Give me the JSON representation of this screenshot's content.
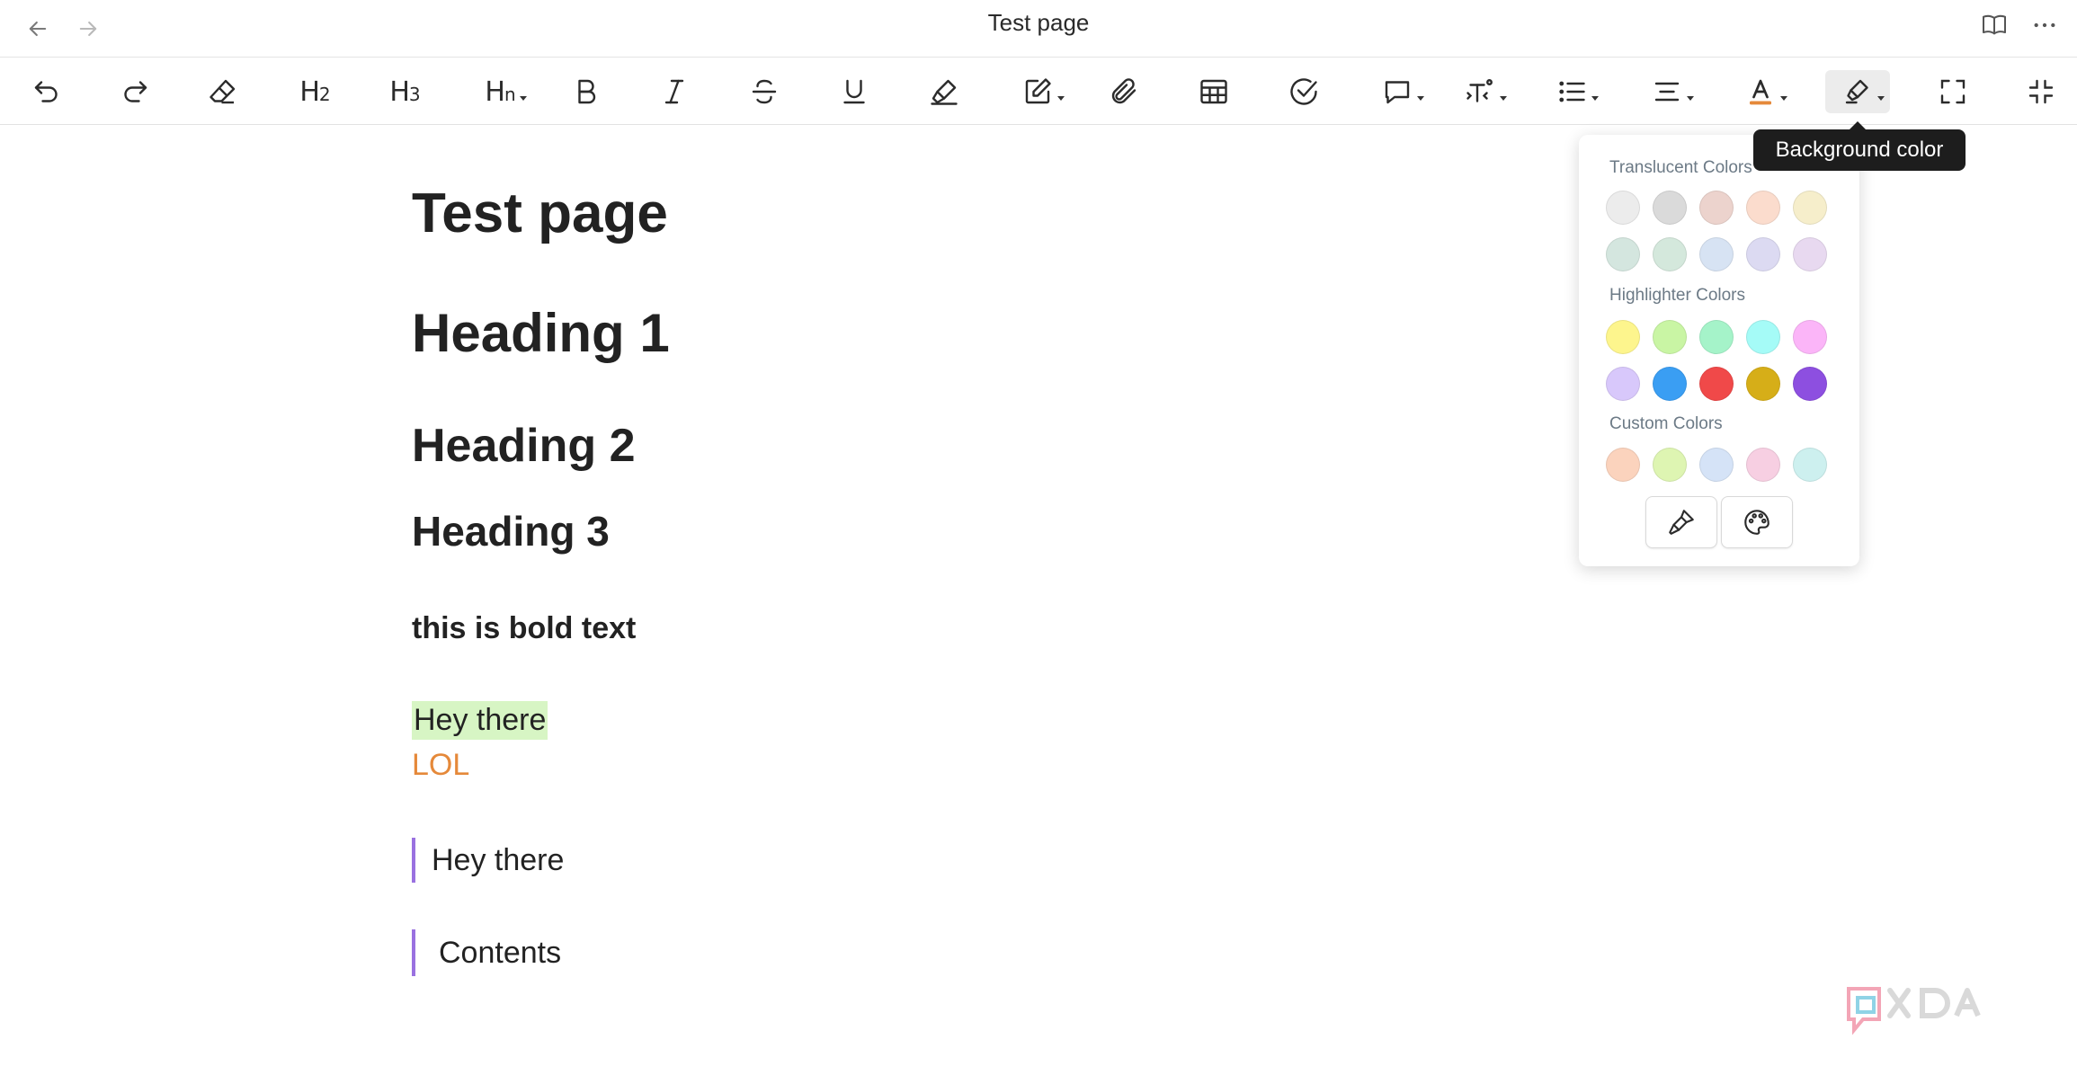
{
  "window": {
    "title": "Test page"
  },
  "toolbar": {
    "h2_label": "H",
    "h2_sub": "2",
    "h3_label": "H",
    "h3_sub": "3",
    "hn_label": "H",
    "hn_sub": "n",
    "text_color_accent": "#e5893a"
  },
  "tooltip": {
    "text": "Background color"
  },
  "color_popover": {
    "translucent_label": "Translucent Colors",
    "translucent_colors": [
      "#ececec",
      "#dadada",
      "#ecd3cd",
      "#fbdccd",
      "#f6eecb",
      "#d4e6df",
      "#d4e8dc",
      "#d7e3f3",
      "#dcdaf2",
      "#e8d9f0"
    ],
    "highlighter_label": "Highlighter Colors",
    "highlighter_colors": [
      "#fdf58d",
      "#c9f5a4",
      "#a5f3c9",
      "#a5fbf7",
      "#fbb5f8",
      "#d8c8fb",
      "#3a9ef3",
      "#f04949",
      "#d6ae18",
      "#8d4fe0"
    ],
    "custom_label": "Custom Colors",
    "custom_colors": [
      "#fbd3bd",
      "#def5b2",
      "#d5e3f7",
      "#f7cfe2",
      "#cdf0ef"
    ]
  },
  "document": {
    "title": "Test page",
    "heading1": "Heading 1",
    "heading2": "Heading 2",
    "heading3": "Heading 3",
    "bold_text": "this is bold text",
    "highlighted_text": "Hey there",
    "orange_text": "LOL",
    "quote1": "Hey there",
    "quote2": "Contents"
  }
}
